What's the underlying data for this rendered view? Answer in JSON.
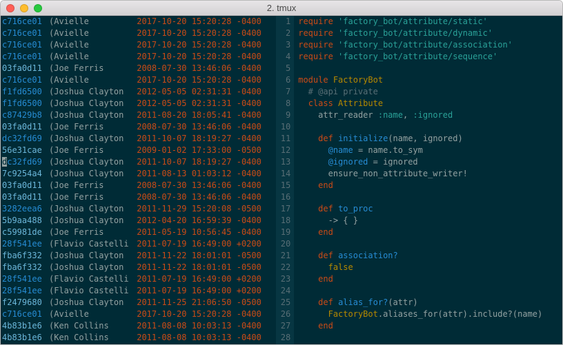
{
  "window": {
    "title": "2. tmux"
  },
  "blame": [
    {
      "hash": "c716ce01",
      "author": "Avielle",
      "date": "2017-10-20 15:20:28 -0400"
    },
    {
      "hash": "c716ce01",
      "author": "Avielle",
      "date": "2017-10-20 15:20:28 -0400"
    },
    {
      "hash": "c716ce01",
      "author": "Avielle",
      "date": "2017-10-20 15:20:28 -0400"
    },
    {
      "hash": "c716ce01",
      "author": "Avielle",
      "date": "2017-10-20 15:20:28 -0400"
    },
    {
      "hash": "03fa0d11",
      "author": "Joe Ferris",
      "date": "2008-07-30 13:46:06 -0400"
    },
    {
      "hash": "c716ce01",
      "author": "Avielle",
      "date": "2017-10-20 15:20:28 -0400"
    },
    {
      "hash": "f1fd6500",
      "author": "Joshua Clayton",
      "date": "2012-05-05 02:31:31 -0400"
    },
    {
      "hash": "f1fd6500",
      "author": "Joshua Clayton",
      "date": "2012-05-05 02:31:31 -0400"
    },
    {
      "hash": "c87429b8",
      "author": "Joshua Clayton",
      "date": "2011-08-20 18:05:41 -0400"
    },
    {
      "hash": "03fa0d11",
      "author": "Joe Ferris",
      "date": "2008-07-30 13:46:06 -0400"
    },
    {
      "hash": "dc32fd69",
      "author": "Joshua Clayton",
      "date": "2011-10-07 18:19:27 -0400"
    },
    {
      "hash": "56e31cae",
      "author": "Joe Ferris",
      "date": "2009-01-02 17:33:00 -0500"
    },
    {
      "hash": "dc32fd69",
      "author": "Joshua Clayton",
      "date": "2011-10-07 18:19:27 -0400"
    },
    {
      "hash": "7c9254a4",
      "author": "Joshua Clayton",
      "date": "2011-08-13 01:03:12 -0400"
    },
    {
      "hash": "03fa0d11",
      "author": "Joe Ferris",
      "date": "2008-07-30 13:46:06 -0400"
    },
    {
      "hash": "03fa0d11",
      "author": "Joe Ferris",
      "date": "2008-07-30 13:46:06 -0400"
    },
    {
      "hash": "3282eea6",
      "author": "Joshua Clayton",
      "date": "2011-11-29 15:20:08 -0500"
    },
    {
      "hash": "5b9aa488",
      "author": "Joshua Clayton",
      "date": "2012-04-20 16:59:39 -0400"
    },
    {
      "hash": "c59981de",
      "author": "Joe Ferris",
      "date": "2011-05-19 10:56:45 -0400"
    },
    {
      "hash": "28f541ee",
      "author": "Flavio Castelli",
      "date": "2011-07-19 16:49:00 +0200"
    },
    {
      "hash": "fba6f332",
      "author": "Joshua Clayton",
      "date": "2011-11-22 18:01:01 -0500"
    },
    {
      "hash": "fba6f332",
      "author": "Joshua Clayton",
      "date": "2011-11-22 18:01:01 -0500"
    },
    {
      "hash": "28f541ee",
      "author": "Flavio Castelli",
      "date": "2011-07-19 16:49:00 +0200"
    },
    {
      "hash": "28f541ee",
      "author": "Flavio Castelli",
      "date": "2011-07-19 16:49:00 +0200"
    },
    {
      "hash": "f2479680",
      "author": "Joshua Clayton",
      "date": "2011-11-25 21:06:50 -0500"
    },
    {
      "hash": "c716ce01",
      "author": "Avielle",
      "date": "2017-10-20 15:20:28 -0400"
    },
    {
      "hash": "4b83b1e6",
      "author": "Ken Collins",
      "date": "2011-08-08 10:03:13 -0400"
    },
    {
      "hash": "4b83b1e6",
      "author": "Ken Collins",
      "date": "2011-08-08 10:03:13 -0400"
    }
  ],
  "code": {
    "lines": [
      {
        "n": 1,
        "t": "require",
        "s": "'factory_bot/attribute/static'"
      },
      {
        "n": 2,
        "t": "require",
        "s": "'factory_bot/attribute/dynamic'"
      },
      {
        "n": 3,
        "t": "require",
        "s": "'factory_bot/attribute/association'"
      },
      {
        "n": 4,
        "t": "require",
        "s": "'factory_bot/attribute/sequence'"
      },
      {
        "n": 5,
        "empty": true
      },
      {
        "n": 6,
        "t": "module",
        "c": "FactoryBot"
      },
      {
        "n": 7,
        "cmt": "  # @api private"
      },
      {
        "n": 8,
        "t": "class",
        "c": "Attribute",
        "ind": "  "
      },
      {
        "n": 9,
        "raw": "    attr_reader :name, :ignored"
      },
      {
        "n": 10,
        "empty": true
      },
      {
        "n": 11,
        "t": "def",
        "d": "initialize",
        "args": "(name, ignored)",
        "ind": "    "
      },
      {
        "n": 12,
        "raw": "      @name = name.to_sym"
      },
      {
        "n": 13,
        "raw": "      @ignored = ignored"
      },
      {
        "n": 14,
        "raw": "      ensure_non_attribute_writer!"
      },
      {
        "n": 15,
        "t": "end",
        "ind": "    "
      },
      {
        "n": 16,
        "empty": true
      },
      {
        "n": 17,
        "t": "def",
        "d": "to_proc",
        "ind": "    "
      },
      {
        "n": 18,
        "raw": "      -> { }"
      },
      {
        "n": 19,
        "t": "end",
        "ind": "    "
      },
      {
        "n": 20,
        "empty": true
      },
      {
        "n": 21,
        "t": "def",
        "d": "association?",
        "ind": "    "
      },
      {
        "n": 22,
        "raw": "      false",
        "bool": true
      },
      {
        "n": 23,
        "t": "end",
        "ind": "    "
      },
      {
        "n": 24,
        "empty": true
      },
      {
        "n": 25,
        "t": "def",
        "d": "alias_for?",
        "args": "(attr)",
        "ind": "    "
      },
      {
        "n": 26,
        "raw": "      FactoryBot.aliases_for(attr).include?(name)",
        "fb": true
      },
      {
        "n": 27,
        "t": "end",
        "ind": "    "
      },
      {
        "n": 28,
        "empty": true
      }
    ]
  }
}
